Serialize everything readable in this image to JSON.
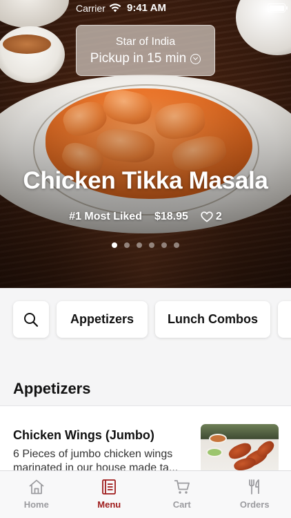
{
  "status_bar": {
    "carrier": "Carrier",
    "time": "9:41 AM"
  },
  "pickup": {
    "store": "Star of India",
    "label": "Pickup in 15 min"
  },
  "featured": {
    "title": "Chicken Tikka Masala",
    "badge": "#1 Most Liked",
    "price": "$18.95",
    "likes": "2",
    "slide_count": 6,
    "active_slide": 0
  },
  "categories": {
    "search_icon": "search-icon",
    "items": [
      "Appetizers",
      "Lunch Combos"
    ]
  },
  "section": {
    "title": "Appetizers"
  },
  "menu_items": [
    {
      "name": "Chicken Wings (Jumbo)",
      "description": "6 Pieces of jumbo chicken wings marinated in our house made ta..."
    }
  ],
  "tabbar": {
    "tabs": [
      {
        "label": "Home",
        "icon": "home-icon",
        "active": false
      },
      {
        "label": "Menu",
        "icon": "menu-icon",
        "active": true
      },
      {
        "label": "Cart",
        "icon": "cart-icon",
        "active": false
      },
      {
        "label": "Orders",
        "icon": "orders-icon",
        "active": false
      }
    ]
  },
  "colors": {
    "accent": "#9e1b1b",
    "inactive": "#9b9b9f",
    "background": "#f5f5f6"
  }
}
